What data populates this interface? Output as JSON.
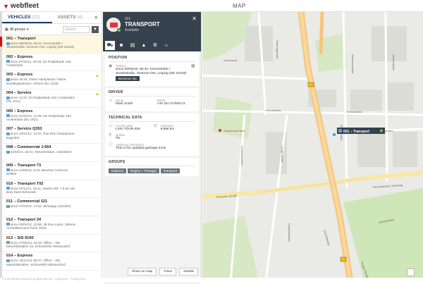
{
  "app": {
    "logo": "webfleet",
    "map_title": "MAP"
  },
  "tabs": [
    {
      "label": "VEHICLES",
      "count": "(22)"
    },
    {
      "label": "ASSETS",
      "count": "(4)"
    }
  ],
  "filter": {
    "group": "All groups",
    "search_placeholder": "Search"
  },
  "vehicles": [
    {
      "name": "001 – Transport",
      "l1": "since 06/06/16, 08:42, Kreuzstraße /",
      "l2": "Stoelestraße, Zentrum-Ost, Leipzig (DE 04103)",
      "warn": false
    },
    {
      "name": "002 – Express",
      "l1": "since 07/11/11, 18:49, De Ruijterkade 149,",
      "l2": "Amsterdam",
      "warn": false
    },
    {
      "name": "003 – Express",
      "l1": "since 19:46, Oliver Hardystraat / Marie",
      "l2": "Bradleyplantsoen, Almere (NL 1325)",
      "warn": true
    },
    {
      "name": "004 – Service",
      "l1": "since 14:37, De Ruijterkade 152, Amsterdam",
      "l2": "(NL 1011)",
      "warn": true
    },
    {
      "name": "005 – Express",
      "l1": "since 21/05/12, 12:05, De Ruijterkade 152,",
      "l2": "Amsterdam (NL 1011)",
      "warn": false
    },
    {
      "name": "007 – Service Q353",
      "l1": "since 23/11/12, 13:32, Rue Des Champeaux,",
      "l2": "Bagnolet",
      "warn": false
    },
    {
      "name": "008 – Commercial J-564",
      "l1": "11/02/13, 16:21, Tebussmbaan, IJsselstein",
      "l2": "",
      "warn": false
    },
    {
      "name": "009 – Transport 73",
      "l1": "since 14/09/12, 8:22, Beucher Crescent,",
      "l2": "Belfast",
      "warn": false
    },
    {
      "name": "010 – Transport T02",
      "l1": "since 07/11/11, 16:11, Station Hill, 7.9 km SE",
      "l2": "Bury Saint Edmunds",
      "warn": false
    },
    {
      "name": "011 – Commercial 121",
      "l1": "since 27/02/12, 14:52, Montaigu (Vendée)",
      "l2": "",
      "warn": false
    },
    {
      "name": "012 – Transport 34",
      "l1": "since 03/04/12, 23:58, 38 Rue Latort, 18Ième",
      "l2": "Arrondissement Paris, Paris",
      "warn": false
    },
    {
      "name": "013 – SIS 9100",
      "l1": "since 27/06/13, 18:43, Office – DE,",
      "l2": "Maximilianallee 13, Schönefeld-Abtnaundorf,",
      "warn": false
    },
    {
      "name": "014 – Express",
      "l1": "since 19/12/13, 08:37, Office – DE,",
      "l2": "Maximilianallee, Schönefeld-Abtnaundorf,",
      "warn": false
    }
  ],
  "detail": {
    "id": "001",
    "title": "TRANSPORT",
    "status": "Available",
    "position": {
      "header": "POSITION",
      "label": "Position",
      "value": "since 06/06/16, 08:42, Kreuzstraße / Stoelestraße, Zentrum-Ost, Leipzig (DE 04103)",
      "button": "Business trip"
    },
    "driver": {
      "header": "DRIVER",
      "name_label": "Name",
      "name": "Mark Smith",
      "mobile_label": "Mobile",
      "mobile": "+49 151 57396174"
    },
    "technical": {
      "header": "TECHNICAL DATA",
      "plate_label": "License plate",
      "plate": "LIVE TOUR-028",
      "odo_label": "Odometer",
      "odo": "9,998 km",
      "ign_label": "Ignition",
      "ign": "On",
      "add_label": "Additional information",
      "add": "This is the updated garbage truck"
    },
    "groups": {
      "header": "GROUPS",
      "tags": [
        "National",
        "Region – Portugal",
        "Transport"
      ]
    },
    "buttons": {
      "show_on_map": "Show on map",
      "trace": "Trace",
      "details": "Details"
    }
  },
  "map": {
    "vehicle_label": "001 – Transport",
    "streets": [
      "Kreuzstraße",
      "Kreuzstraße",
      "Dresdner Straße",
      "Gerichtsweg",
      "Schützenstraße",
      "Lange Straße",
      "Stoelestraße",
      "Grimmaischer Steinweg",
      "Seeburgstraße",
      "Salomonstraße",
      "Hospitalstraße",
      "Kohlgartenstraße",
      "Gellertstraße",
      "Salzmanns",
      "Lutherstraße",
      "Prager Straße"
    ],
    "poi": [
      "Schauhaus Haus"
    ]
  },
  "footer": "© 2018 Webfleet Solutions. All rights reserved.  ·  Legal terms  ·  Privacy policy",
  "colors": {
    "brand": "#e2001a",
    "header": "#35424d",
    "main_road": "#f6c57e",
    "road_secondary": "#fae7a6",
    "park": "#cfe6b8",
    "selected_row": "#fff7df"
  }
}
